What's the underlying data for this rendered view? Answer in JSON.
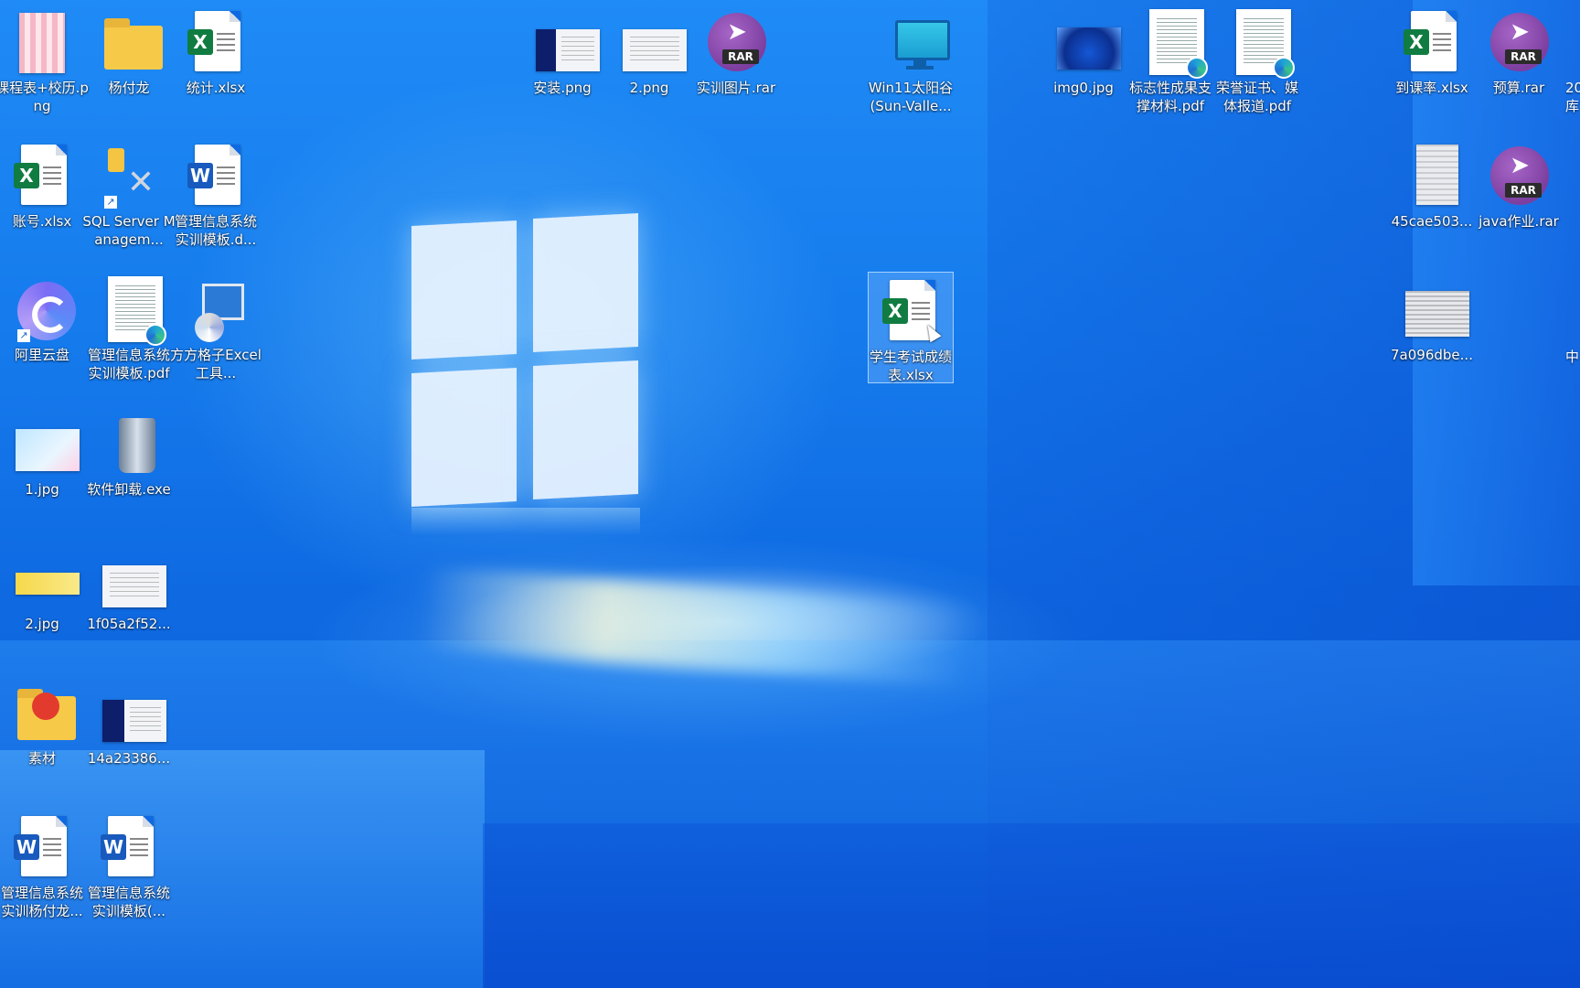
{
  "desktop": {
    "icons": [
      {
        "label": "课程表+校历.png",
        "kind": "image"
      },
      {
        "label": "杨付龙",
        "kind": "folder"
      },
      {
        "label": "统计.xlsx",
        "kind": "excel"
      },
      {
        "label": "安装.png",
        "kind": "screenshot"
      },
      {
        "label": "2.png",
        "kind": "screenshot"
      },
      {
        "label": "实训图片.rar",
        "kind": "rar"
      },
      {
        "label": "Win11太阳谷 (Sun-Valle...",
        "kind": "monitor"
      },
      {
        "label": "img0.jpg",
        "kind": "image"
      },
      {
        "label": "标志性成果支撑材料.pdf",
        "kind": "pdf"
      },
      {
        "label": "荣誉证书、媒体报道.pdf",
        "kind": "pdf"
      },
      {
        "label": "到课率.xlsx",
        "kind": "excel"
      },
      {
        "label": "预算.rar",
        "kind": "rar"
      },
      {
        "label": "账号.xlsx",
        "kind": "excel"
      },
      {
        "label": "SQL Server Managem...",
        "kind": "tool"
      },
      {
        "label": "管理信息系统实训模板.d...",
        "kind": "word"
      },
      {
        "label": "45cae503...",
        "kind": "image"
      },
      {
        "label": "java作业.rar",
        "kind": "rar"
      },
      {
        "label": "阿里云盘",
        "kind": "app"
      },
      {
        "label": "管理信息系统实训模板.pdf",
        "kind": "pdf"
      },
      {
        "label": "方方格子Excel工具...",
        "kind": "installer"
      },
      {
        "label": "学生考试成绩表.xlsx",
        "kind": "excel"
      },
      {
        "label": "7a096dbe...",
        "kind": "image"
      },
      {
        "label": "1.jpg",
        "kind": "image"
      },
      {
        "label": "软件卸载.exe",
        "kind": "exe"
      },
      {
        "label": "2.jpg",
        "kind": "image"
      },
      {
        "label": "1f05a2f52...",
        "kind": "image"
      },
      {
        "label": "素材",
        "kind": "folder"
      },
      {
        "label": "14a23386...",
        "kind": "image"
      },
      {
        "label": "管理信息系统实训杨付龙...",
        "kind": "word"
      },
      {
        "label": "管理信息系统实训模板(...",
        "kind": "word"
      }
    ],
    "selected_icon": "学生考试成绩表.xlsx",
    "edge_partial_labels": [
      "20",
      "库",
      "中"
    ]
  },
  "badges": {
    "excel": "X",
    "word": "W",
    "rar": "RAR"
  },
  "colors": {
    "accent": "#0f6ae2",
    "excel": "#107c41",
    "word": "#185abd",
    "rar": "#7c3fa0"
  }
}
